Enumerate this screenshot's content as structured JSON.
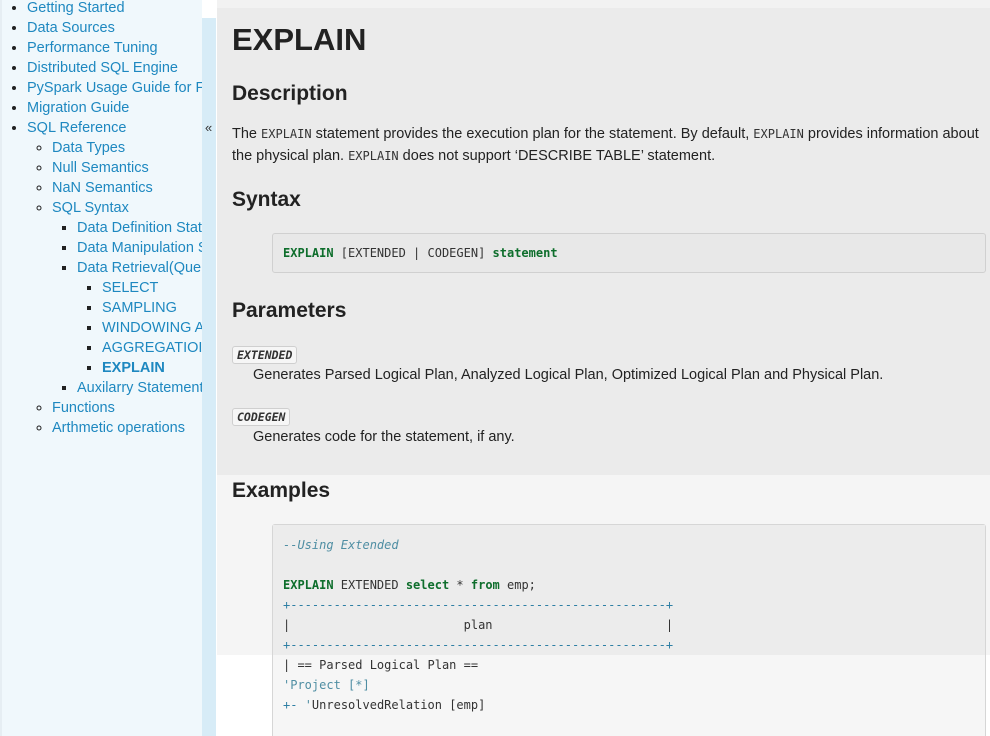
{
  "sidebar": {
    "items": [
      {
        "label": "Getting Started"
      },
      {
        "label": "Data Sources"
      },
      {
        "label": "Performance Tuning"
      },
      {
        "label": "Distributed SQL Engine"
      },
      {
        "label": "PySpark Usage Guide for F"
      },
      {
        "label": "Migration Guide"
      },
      {
        "label": "SQL Reference"
      }
    ],
    "sql_ref_children": [
      {
        "label": "Data Types"
      },
      {
        "label": "Null Semantics"
      },
      {
        "label": "NaN Semantics"
      },
      {
        "label": "SQL Syntax"
      }
    ],
    "sql_syntax_children": [
      {
        "label": "Data Definition Stat"
      },
      {
        "label": "Data Manipulation S"
      },
      {
        "label": "Data Retrieval(Que"
      }
    ],
    "retrieval_children": [
      {
        "label": "SELECT"
      },
      {
        "label": "SAMPLING"
      },
      {
        "label": "WINDOWING A"
      },
      {
        "label": "AGGREGATIOI"
      },
      {
        "label": "EXPLAIN"
      }
    ],
    "after_syntax": [
      {
        "label": "Auxilarry Statement"
      }
    ],
    "after_sql_ref": [
      {
        "label": "Functions"
      },
      {
        "label": "Arthmetic operations"
      }
    ],
    "collapse_label": "«"
  },
  "page": {
    "title": "EXPLAIN",
    "description_heading": "Description",
    "desc_part1": "The ",
    "desc_code1": "EXPLAIN",
    "desc_part2": " statement provides the execution plan for the statement. By default, ",
    "desc_code2": "EXPLAIN",
    "desc_part3": " provides information about the physical plan. ",
    "desc_code3": "EXPLAIN",
    "desc_part4": " does not support ‘DESCRIBE TABLE’ statement.",
    "syntax_heading": "Syntax",
    "syntax": {
      "kw1": "EXPLAIN",
      "middle": " [EXTENDED | CODEGEN] ",
      "kw2": "statement"
    },
    "parameters_heading": "Parameters",
    "params": [
      {
        "name": "EXTENDED",
        "desc": "Generates Parsed Logical Plan, Analyzed Logical Plan, Optimized Logical Plan and Physical Plan."
      },
      {
        "name": "CODEGEN",
        "desc": "Generates code for the statement, if any."
      }
    ],
    "examples_heading": "Examples",
    "example": {
      "comment": "--Using Extended",
      "kw_explain": "EXPLAIN",
      "extended": " EXTENDED ",
      "kw_select": "select",
      "star": " * ",
      "kw_from": "from",
      "table": " emp;",
      "border": "+----------------------------------------------------+",
      "plan_row": "|                        plan                        |",
      "line_parsed": "| == Parsed Logical Plan ==",
      "line_project": "'Project [*]",
      "line_rel_prefix": "+- ",
      "line_rel_quote": "'",
      "line_rel": "UnresolvedRelation [emp]"
    }
  }
}
